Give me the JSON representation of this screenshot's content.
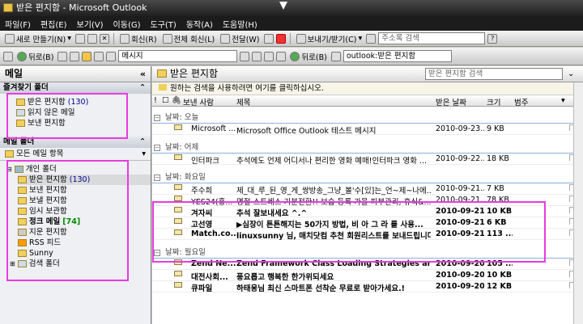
{
  "window": {
    "title": "받은 편지함 - Microsoft Outlook"
  },
  "menu": [
    "파일(F)",
    "편집(E)",
    "보기(V)",
    "이동(G)",
    "도구(T)",
    "동작(A)",
    "도움말(H)"
  ],
  "toolbar1": {
    "new_label": "새로 만들기(N)",
    "reply_label": "회신(R)",
    "reply_all_label": "전체 회신(L)",
    "forward_label": "전달(W)",
    "send_receive_label": "보내기/받기(C)",
    "addressbook_placeholder": "주소록 검색"
  },
  "toolbar2": {
    "back_label": "뒤로(B)",
    "location_label": "메시지",
    "back2_label": "뒤로(B)",
    "address_value": "outlook:받은 편지함"
  },
  "nav": {
    "header": "메일",
    "favorites_title": "즐겨찾기 폴더",
    "favorites": [
      {
        "label": "받은 편지함",
        "count": "(130)"
      },
      {
        "label": "읽지 않은 메일",
        "count": ""
      },
      {
        "label": "보낸 편지함",
        "count": ""
      }
    ],
    "mail_folders_title": "메일 폴더",
    "all_items_label": "모든 메일 항목",
    "personal_folder": "개인 폴더",
    "folders": [
      {
        "label": "받은 편지함",
        "count": "(130)",
        "bold": false,
        "selected": true
      },
      {
        "label": "보낸 편지함",
        "count": "",
        "bold": false
      },
      {
        "label": "보낼 편지함",
        "count": "",
        "bold": false
      },
      {
        "label": "임시 보관함",
        "count": "",
        "bold": false
      },
      {
        "label": "정크 메일",
        "count": "[74]",
        "bold": true
      },
      {
        "label": "지운 편지함",
        "count": "",
        "bold": false
      },
      {
        "label": "RSS 피드",
        "count": "",
        "bold": false
      },
      {
        "label": "Sunny",
        "count": "",
        "bold": false
      },
      {
        "label": "검색 폴더",
        "count": "",
        "bold": false
      }
    ]
  },
  "inbox": {
    "title": "받은 편지함",
    "search_placeholder": "받은 편지함 검색",
    "hint": "원하는 검색을 사용하려면 여기를 클릭하십시오.",
    "columns": {
      "from": "보낸 사람",
      "subject": "제목",
      "received": "받은 날짜",
      "size": "크기",
      "category": "범주"
    },
    "groups": [
      {
        "label": "날짜: 오늘",
        "rows": [
          {
            "from": "Microsoft ...",
            "subject": "Microsoft Office Outlook 테스트 메시지",
            "date": "2010-09-23...",
            "size": "9 KB",
            "bold": false
          }
        ]
      },
      {
        "label": "날짜: 어제",
        "rows": [
          {
            "from": "인터파크",
            "subject": "추석에도 언제 어디서나 편리한 영화 예매!인터파크 영화 ...",
            "date": "2010-09-22...",
            "size": "18 KB",
            "bold": false
          }
        ]
      },
      {
        "label": "날짜: 화요일",
        "rows": [
          {
            "from": "주수희",
            "subject": "제_대_루_된_영_게_쌍방송_그냥_볼'수[있]는_언~제~나에...",
            "date": "2010-09-21...",
            "size": "7 KB",
            "bold": false
          },
          {
            "from": "YES24(홍...",
            "subject": "명절 스트레스 기분전환!! 보습 등록 가을 피부관리, 휴식&...",
            "date": "2010-09-21...",
            "size": "78 KB",
            "bold": false
          },
          {
            "from": "겨자씨",
            "subject": "추석 잘보내세요 ^.^",
            "date": "2010-09-21...",
            "size": "10 KB",
            "bold": true
          },
          {
            "from": "고선영",
            "subject": "▶심장이 튼튼해지는 50가지 방법, 비 아 그 라 를 사용...",
            "date": "2010-09-21...",
            "size": "6 KB",
            "bold": true
          },
          {
            "from": "Match.co...",
            "subject": "linuxsunny 님, 매치닷컴 추천 회원리스트를 보내드립니다",
            "date": "2010-09-21...",
            "size": "113 ...",
            "bold": true
          }
        ]
      },
      {
        "label": "날짜: 월요일",
        "rows": [
          {
            "from": "Zend Ne...",
            "subject": "Zend Framework Class Loading Strategies and Perfor...",
            "date": "2010-09-20...",
            "size": "105 ...",
            "bold": true
          },
          {
            "from": "대전사회...",
            "subject": "풍요롭고 행복한 한가위되세요",
            "date": "2010-09-20...",
            "size": "10 KB",
            "bold": true
          },
          {
            "from": "큐파일",
            "subject": "하태웅님 최신 스마트폰 선착순 무료로 받아가세요.!",
            "date": "2010-09-20...",
            "size": "12 KB",
            "bold": true
          }
        ]
      }
    ]
  },
  "colors": {
    "highlight": "#e83be0",
    "folder": "#f1cf5d",
    "title_bar": "#2b2b2b"
  }
}
